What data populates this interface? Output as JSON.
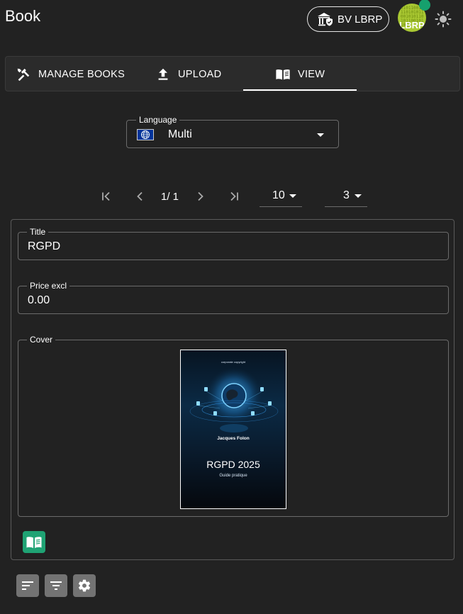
{
  "header": {
    "title": "Book",
    "org_label": "BV LBRP",
    "org_icon": "bank-shield-icon",
    "avatar_initials": "LBRP",
    "avatar_digits": "0101100101101010110010101101011001011010",
    "presence_color": "#16a06d",
    "theme_icon": "sun-icon"
  },
  "tabs": [
    {
      "label": "MANAGE BOOKS",
      "icon": "tools-icon",
      "active": false
    },
    {
      "label": "UPLOAD",
      "icon": "upload-icon",
      "active": false
    },
    {
      "label": "VIEW",
      "icon": "book-open-icon",
      "active": true
    }
  ],
  "language": {
    "label": "Language",
    "value": "Multi",
    "flag_icon": "globe-flag-icon"
  },
  "pager": {
    "info": "1/ 1",
    "rows_per_page": "10",
    "columns": "3"
  },
  "record": {
    "title_label": "Title",
    "title_value": "RGPD",
    "price_label": "Price excl",
    "price_value": "0.00",
    "cover_label": "Cover",
    "cover": {
      "top_text": "corporate copyright",
      "author": "Jacques Folon",
      "title": "RGPD 2025",
      "subtitle": "Guide pratique"
    },
    "open_button_icon": "open-book-icon"
  },
  "toolbar": [
    {
      "icon": "sort-icon"
    },
    {
      "icon": "filter-icon"
    },
    {
      "icon": "settings-gear-icon"
    }
  ],
  "colors": {
    "background": "#222222",
    "accent_green": "#1fa374",
    "avatar_green": "#a9c832",
    "tool_button": "#737373"
  }
}
